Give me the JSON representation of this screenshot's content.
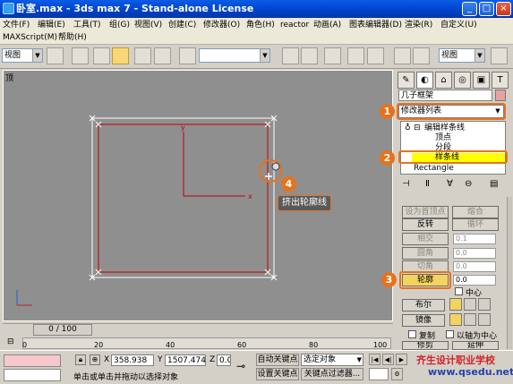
{
  "window": {
    "title": "卧室.max - 3ds max 7 - Stand-alone License",
    "minimize": "_",
    "maximize": "□",
    "close": "×"
  },
  "menu": {
    "file": "文件(F)",
    "edit": "编辑(E)",
    "tools": "工具(T)",
    "group": "组(G)",
    "views": "视图(V)",
    "create": "创建(C)",
    "modifiers": "修改器(O)",
    "reactor": "reactor",
    "animation": "动画(A)",
    "graph_editors": "图表编辑器(D)",
    "rendering": "渲染(R)",
    "customize": "自定义(U)",
    "maxscript": "MAXScript(M)",
    "help": "帮助(H)"
  },
  "toolbar": {
    "view_combo_left": "视图",
    "view_combo_right": "视图"
  },
  "viewport": {
    "label": "顶",
    "axis_x": "x",
    "axis_y": "y"
  },
  "callout": {
    "step4": "4",
    "tooltip": "挤出轮廓线"
  },
  "panel": {
    "object_name": "几子框架",
    "modifier_list": "修改器列表",
    "stack": {
      "edit_spline": "编辑样条线",
      "vertex": "顶点",
      "segment": "分段",
      "spline": "样条线",
      "rectangle": "Rectangle"
    },
    "buttons": {
      "set_first_vertex": "设为首顶点",
      "fuse": "熔合",
      "reverse": "反转",
      "cycle": "循环",
      "intersect": "相交",
      "fillet": "圆角",
      "chamfer": "切角",
      "outline": "轮廓",
      "center": "中心",
      "boolean": "布尔",
      "mirror": "镜像",
      "copy": "复制",
      "about_pivot": "以轴为中心",
      "trim": "修剪",
      "extend": "延伸"
    },
    "spinners": {
      "intersect_val": "0.1",
      "fillet_val": "0.0",
      "chamfer_val": "0.0",
      "outline_val": "0.0"
    },
    "steps": {
      "s1": "1",
      "s2": "2",
      "s3": "3"
    }
  },
  "timeline": {
    "frame_counter": "0 / 100",
    "ticks": [
      "0",
      "20",
      "40",
      "60",
      "80",
      "100"
    ]
  },
  "status": {
    "x_label": "X",
    "x_value": "358.938",
    "y_label": "Y",
    "y_value": "1507.474",
    "z_label": "Z",
    "z_value": "0.0",
    "auto_key": "自动关键点",
    "set_key": "设置关键点",
    "selected_object": "选定对象",
    "key_filters": "关键点过滤器...",
    "prompt": "单击或单击并拖动以选择对象",
    "watermark_cn": "齐生设计职业学校",
    "watermark_url": "www.qsedu.net"
  },
  "colors": {
    "title_blue": "#0042c8",
    "viewport_gray": "#8f8f8f",
    "annotation_orange": "#e8721c",
    "spline_red": "#c00000",
    "highlight_yellow": "#ffff00"
  }
}
